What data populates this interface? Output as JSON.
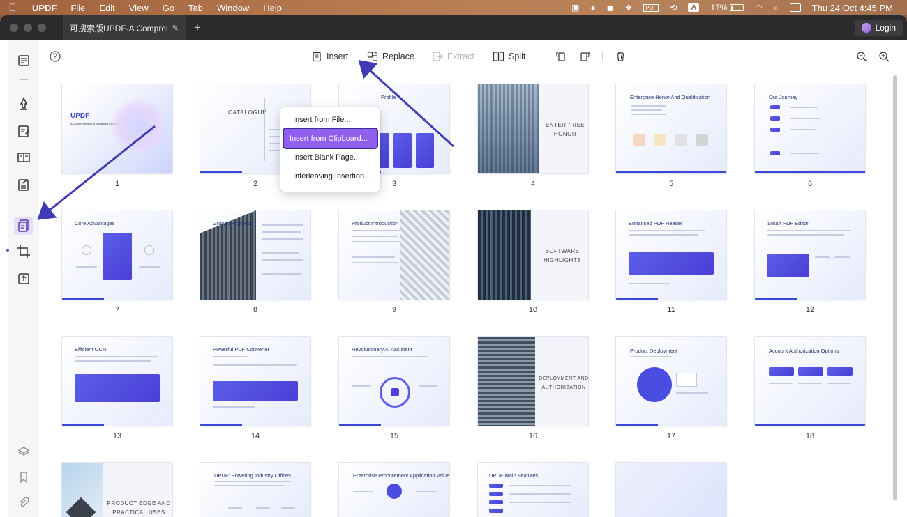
{
  "menubar": {
    "app_name": "UPDF",
    "items": [
      "File",
      "Edit",
      "View",
      "Go",
      "Tab",
      "Window",
      "Help"
    ],
    "battery": "17%",
    "datetime": "Thu 24 Oct  4:45 PM",
    "keyboard_indicator": "A",
    "pdf_badge": "PDF"
  },
  "titlebar": {
    "tab_title": "可搜索版UPDF-A Comprehensive…",
    "login_label": "Login"
  },
  "toolbar": {
    "insert_label": "Insert",
    "replace_label": "Replace",
    "extract_label": "Extract",
    "split_label": "Split"
  },
  "insert_menu": {
    "options": [
      "Insert from File...",
      "Insert from Clipboard...",
      "Insert Blank Page...",
      "Interleaving Insertion..."
    ],
    "selected_index": 1
  },
  "pages": [
    {
      "num": "1",
      "title": "UPDF",
      "subtitle": "A Comprehensive & Advanced PDF Editor"
    },
    {
      "num": "2",
      "title": "CATALOGUE"
    },
    {
      "num": "3",
      "title": "Profile"
    },
    {
      "num": "4",
      "title": "ENTERPRISE",
      "title2": "HONOR"
    },
    {
      "num": "5",
      "title": "Enterprise Honor And Qualification"
    },
    {
      "num": "6",
      "title": "Our Journey"
    },
    {
      "num": "7",
      "title": "Core Advantages"
    },
    {
      "num": "8",
      "title": "Growth Prospect"
    },
    {
      "num": "9",
      "title": "Product Introduction"
    },
    {
      "num": "10",
      "title": "SOFTWARE",
      "title2": "HIGHLIGHTS"
    },
    {
      "num": "11",
      "title": "Enhanced PDF Reader"
    },
    {
      "num": "12",
      "title": "Smart PDF Editor"
    },
    {
      "num": "13",
      "title": "Efficient OCR"
    },
    {
      "num": "14",
      "title": "Powerful PDF Converter"
    },
    {
      "num": "15",
      "title": "Revolutionary AI Assistant"
    },
    {
      "num": "16",
      "title": "DEPLOYMENT AND",
      "title2": "AUTHORIZATION"
    },
    {
      "num": "17",
      "title": "Product Deployment"
    },
    {
      "num": "18",
      "title": "Account Authorization Options"
    },
    {
      "num": "",
      "title": "PRODUCT EDGE AND",
      "title2": "PRACTICAL USES"
    },
    {
      "num": "",
      "title": "UPDF: Powering Industry Offices"
    },
    {
      "num": "",
      "title": "Enterprise Procurement Application Value"
    },
    {
      "num": "",
      "title": "UPDF Main Features"
    },
    {
      "num": "",
      "title": ""
    }
  ],
  "colors": {
    "accent": "#8f5ff0",
    "arrow": "#3f3bb5",
    "brand": "#3a46d8"
  }
}
